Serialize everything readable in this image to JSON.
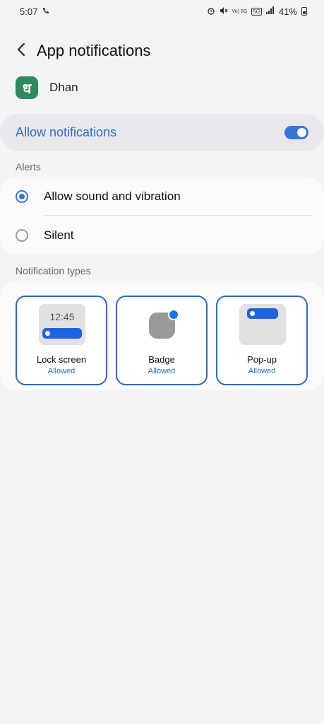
{
  "status_bar": {
    "time": "5:07",
    "battery": "41%",
    "network": "5G",
    "volte": "Vo) 5G"
  },
  "header": {
    "title": "App notifications",
    "back_icon": "chevron-left-icon"
  },
  "app": {
    "name": "Dhan",
    "icon_glyph": "ध",
    "icon_color": "#2f8a5e"
  },
  "allow_notifications": {
    "label": "Allow notifications",
    "enabled": true,
    "accent": "#2b6fcf"
  },
  "alerts": {
    "section_label": "Alerts",
    "options": [
      {
        "label": "Allow sound and vibration",
        "selected": true
      },
      {
        "label": "Silent",
        "selected": false
      }
    ]
  },
  "notification_types": {
    "section_label": "Notification types",
    "tiles": [
      {
        "title": "Lock screen",
        "status": "Allowed",
        "preview_time": "12:45"
      },
      {
        "title": "Badge",
        "status": "Allowed"
      },
      {
        "title": "Pop-up",
        "status": "Allowed"
      }
    ]
  }
}
